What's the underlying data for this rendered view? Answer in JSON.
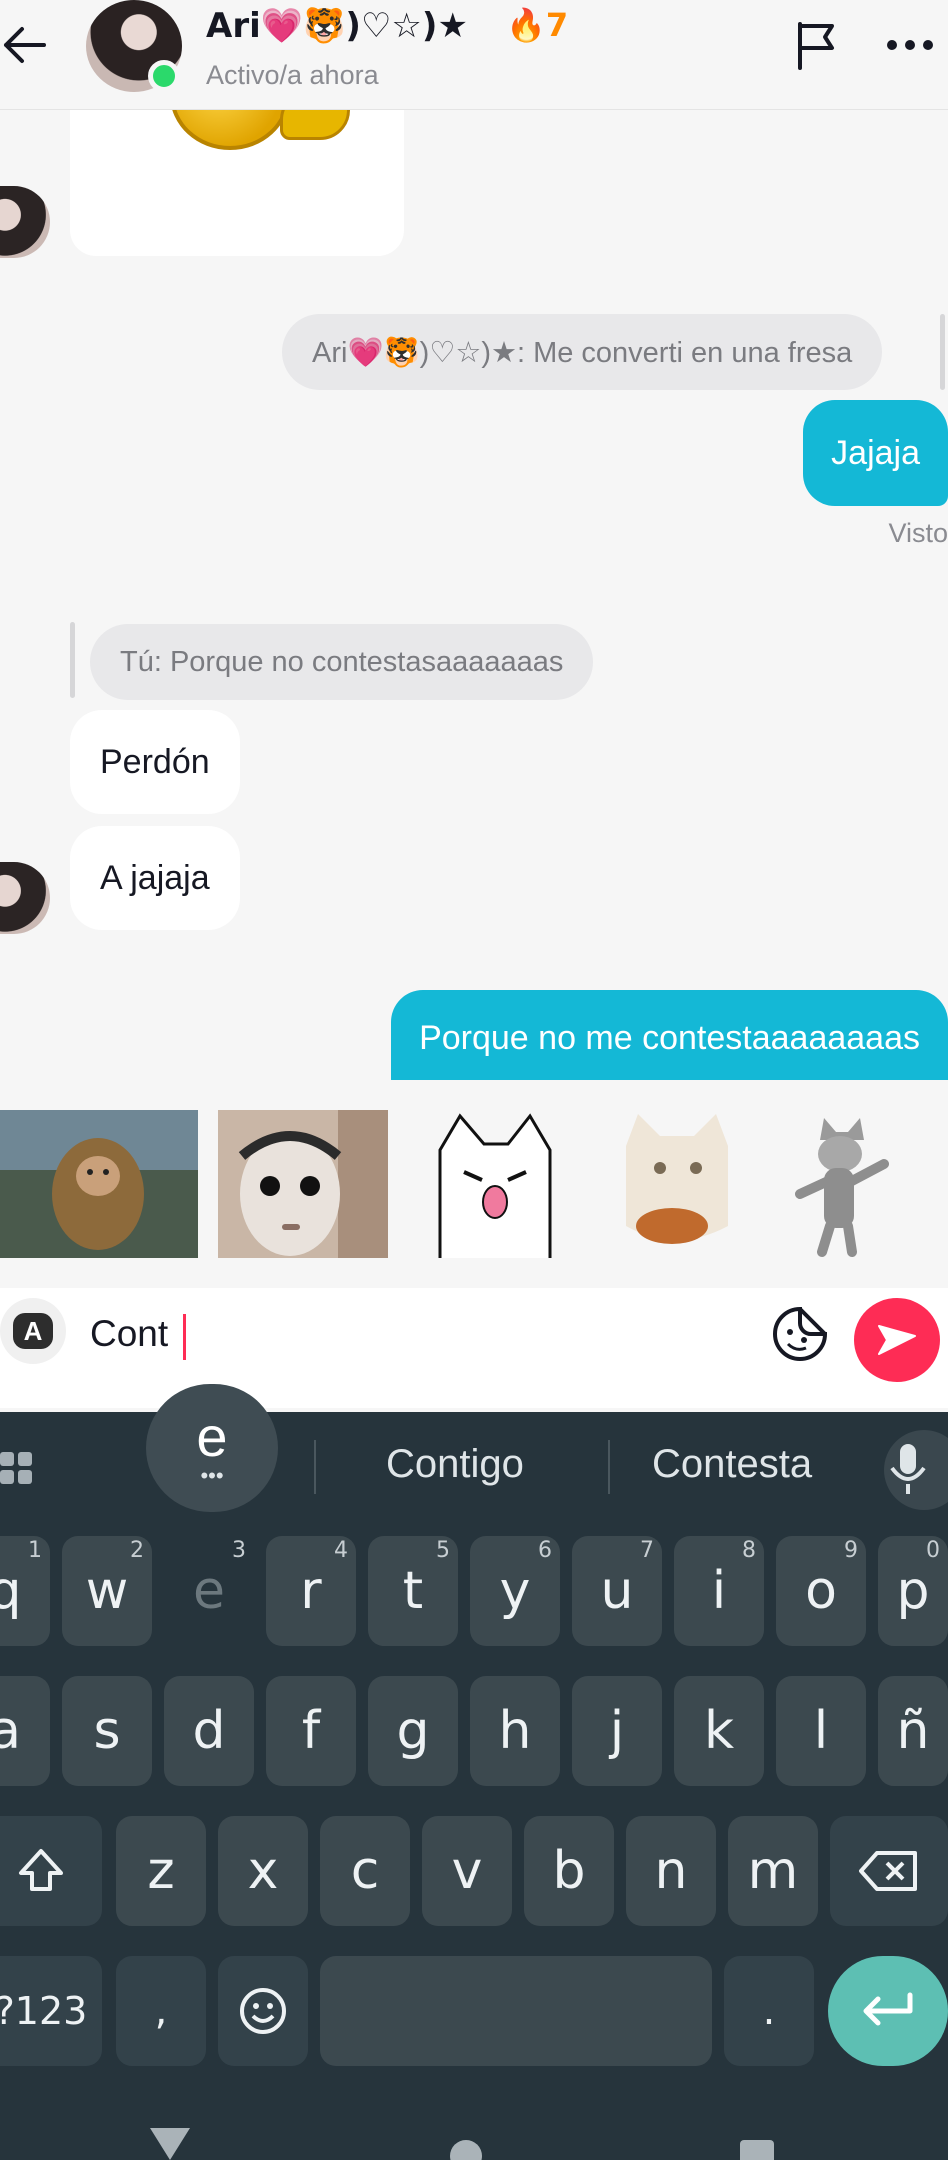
{
  "header": {
    "name": "Ari💗🐯)♡☆)★",
    "streak_icon": "🔥",
    "streak_count": "7",
    "status": "Activo/a ahora"
  },
  "chat": {
    "reply_received": "Ari💗🐯)♡☆)★: Me converti en una fresa",
    "msg_out_1": "Jajaja",
    "seen": "Visto",
    "reply_mine": "Tú: Porque no contestasaaaaaaas",
    "msg_in_1": "Perdón",
    "msg_in_2": "A jajaja",
    "msg_out_2": "Porque no me contestaaaaaaaas"
  },
  "composer": {
    "input_value": "Cont",
    "keyboard_switch_label": "A"
  },
  "keyboard": {
    "popup_key": "e",
    "popup_dots": "•••",
    "suggestions": [
      "Contigo",
      "Contesta"
    ],
    "row1": [
      {
        "k": "q",
        "n": "1"
      },
      {
        "k": "w",
        "n": "2"
      },
      {
        "k": "e",
        "n": "3"
      },
      {
        "k": "r",
        "n": "4"
      },
      {
        "k": "t",
        "n": "5"
      },
      {
        "k": "y",
        "n": "6"
      },
      {
        "k": "u",
        "n": "7"
      },
      {
        "k": "i",
        "n": "8"
      },
      {
        "k": "o",
        "n": "9"
      },
      {
        "k": "p",
        "n": "0"
      }
    ],
    "row2": [
      "a",
      "s",
      "d",
      "f",
      "g",
      "h",
      "j",
      "k",
      "l",
      "ñ"
    ],
    "row3": [
      "z",
      "x",
      "c",
      "v",
      "b",
      "n",
      "m"
    ],
    "symbols_label": "?123",
    "comma": ",",
    "period": "."
  },
  "colors": {
    "accent_out": "#14b8d6",
    "send": "#fe2c55",
    "online": "#2bd96b",
    "streak": "#ff8a00",
    "keyboard_bg": "#26343c",
    "enter_key": "#5dbfb3"
  }
}
